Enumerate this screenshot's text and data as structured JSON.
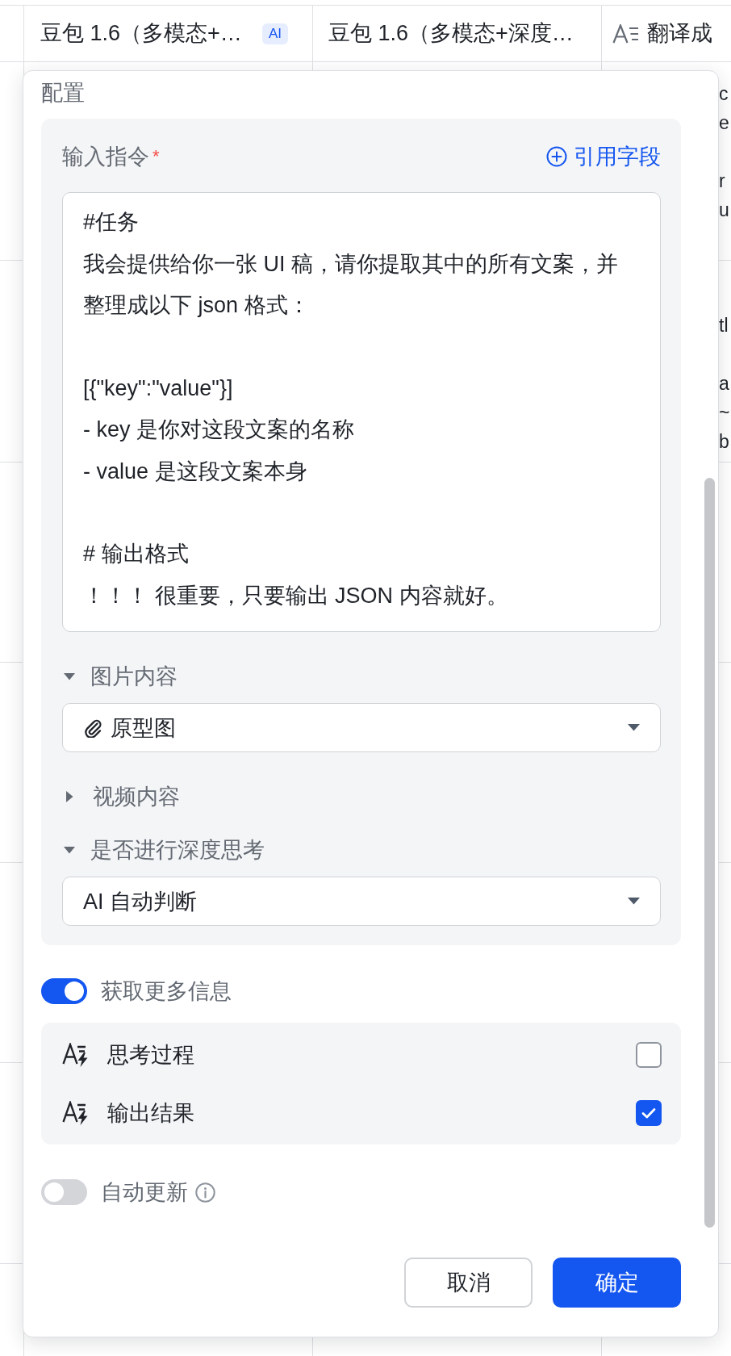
{
  "table": {
    "columns": [
      {
        "title": "豆包 1.6（多模态+…",
        "kind": "plain",
        "badge": "AI"
      },
      {
        "title": "豆包 1.6（多模态+深度…",
        "kind": "plain"
      },
      {
        "title": "翻译成",
        "kind": "text"
      }
    ],
    "column_3_cells": [
      {
        "blocks": [
          [
            "c",
            "e"
          ],
          [
            "r",
            "u"
          ]
        ]
      },
      {
        "blocks": [
          [
            "tl"
          ],
          [
            "a",
            "~",
            "b"
          ]
        ]
      }
    ]
  },
  "dialog": {
    "title": "配置",
    "instruction": {
      "label": "输入指令",
      "required_mark": "*",
      "insert_link": "引用字段",
      "paragraphs": [
        [
          "#任务",
          "我会提供给你一张 UI 稿，请你提取其中的所有文案，并",
          "整理成以下 json 格式："
        ],
        [
          "[{\"key\":\"value\"}]",
          "- key 是你对这段文案的名称",
          "- value 是这段文案本身"
        ],
        [
          "# 输出格式",
          "！！！ 很重要，只要输出 JSON 内容就好。"
        ]
      ]
    },
    "sections": [
      {
        "label": "图片内容",
        "expanded": true,
        "select": {
          "kind": "attachment",
          "value": "原型图"
        }
      },
      {
        "label": "视频内容",
        "expanded": false
      },
      {
        "label": "是否进行深度思考",
        "expanded": true,
        "select": {
          "kind": "option",
          "value": "AI 自动判断"
        }
      }
    ],
    "more_info": {
      "label": "获取更多信息",
      "on": true,
      "options": [
        {
          "label": "思考过程",
          "checked": false
        },
        {
          "label": "输出结果",
          "checked": true
        }
      ]
    },
    "auto_update": {
      "label": "自动更新",
      "on": false,
      "info": true
    },
    "buttons": [
      {
        "label": "取消",
        "kind": "secondary"
      },
      {
        "label": "确定",
        "kind": "primary"
      }
    ]
  }
}
